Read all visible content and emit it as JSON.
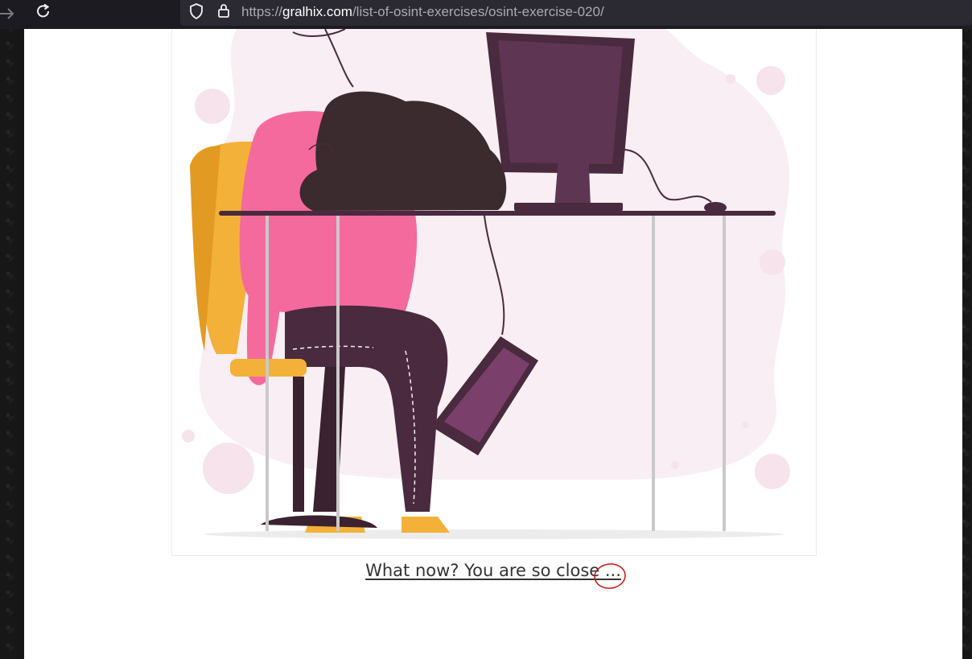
{
  "browser": {
    "url_prefix": "https://",
    "url_domain": "gralhix.com",
    "url_path": "/list-of-osint-exercises/osint-exercise-020/"
  },
  "page": {
    "caption": "What now? You are so close ..."
  },
  "icons": {
    "forward": "arrow-right-icon",
    "reload": "reload-icon",
    "shield": "shield-icon",
    "lock": "lock-icon"
  },
  "colors": {
    "annotation": "#d01010",
    "hoodie": "#f56a9c",
    "chair": "#f3b13a",
    "dark_purple": "#4a2a3e",
    "blob": "#f8eef3"
  }
}
